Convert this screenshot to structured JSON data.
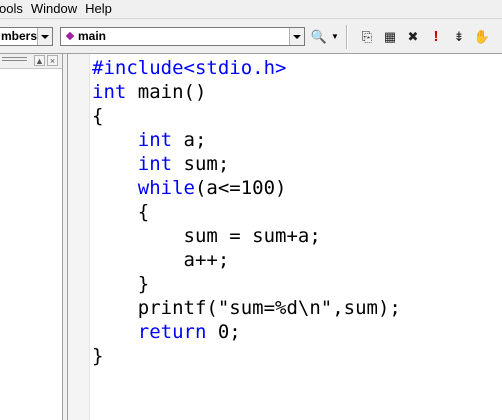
{
  "menubar": {
    "items": [
      "ools",
      "Window",
      "Help"
    ]
  },
  "toolbar": {
    "class_combo_value": "mbers",
    "function_combo_value": "main",
    "buttons": [
      {
        "icon": "find-in-files-icon",
        "glyph": "🔍"
      },
      {
        "icon": "dropdown-arrow-icon",
        "glyph": "▼"
      },
      {
        "icon": "compile-icon",
        "glyph": "⎘"
      },
      {
        "icon": "build-icon",
        "glyph": "▦"
      },
      {
        "icon": "stop-build-icon",
        "glyph": "✖"
      },
      {
        "icon": "execute-icon",
        "glyph": "!"
      },
      {
        "icon": "go-debug-icon",
        "glyph": "⇟"
      },
      {
        "icon": "breakpoint-hand-icon",
        "glyph": "✋"
      }
    ]
  },
  "left_pane": {
    "controls": [
      "▲",
      "×"
    ]
  },
  "editor": {
    "lines": [
      {
        "tokens": [
          {
            "text": "#include<stdio.h>",
            "kw": true
          }
        ]
      },
      {
        "tokens": [
          {
            "text": "int",
            "kw": true
          },
          {
            "text": " main()",
            "kw": false
          }
        ]
      },
      {
        "tokens": [
          {
            "text": "{",
            "kw": false
          }
        ]
      },
      {
        "tokens": [
          {
            "text": "    ",
            "kw": false
          },
          {
            "text": "int",
            "kw": true
          },
          {
            "text": " a;",
            "kw": false
          }
        ]
      },
      {
        "tokens": [
          {
            "text": "    ",
            "kw": false
          },
          {
            "text": "int",
            "kw": true
          },
          {
            "text": " sum;",
            "kw": false
          }
        ]
      },
      {
        "tokens": [
          {
            "text": "    ",
            "kw": false
          },
          {
            "text": "while",
            "kw": true
          },
          {
            "text": "(a<=100)",
            "kw": false
          }
        ]
      },
      {
        "tokens": [
          {
            "text": "    {",
            "kw": false
          }
        ]
      },
      {
        "tokens": [
          {
            "text": "        sum = sum+a;",
            "kw": false
          }
        ]
      },
      {
        "tokens": [
          {
            "text": "        a++;",
            "kw": false
          }
        ]
      },
      {
        "tokens": [
          {
            "text": "    }",
            "kw": false
          }
        ]
      },
      {
        "tokens": [
          {
            "text": "    printf(\"sum=%d\\n\",sum);",
            "kw": false
          }
        ]
      },
      {
        "tokens": [
          {
            "text": "    ",
            "kw": false
          },
          {
            "text": "return",
            "kw": true
          },
          {
            "text": " 0;",
            "kw": false
          }
        ]
      },
      {
        "tokens": [
          {
            "text": "}",
            "kw": false
          }
        ]
      }
    ]
  },
  "colors": {
    "keyword": "#0000ff",
    "text": "#000000",
    "chrome": "#f0f0f0"
  }
}
